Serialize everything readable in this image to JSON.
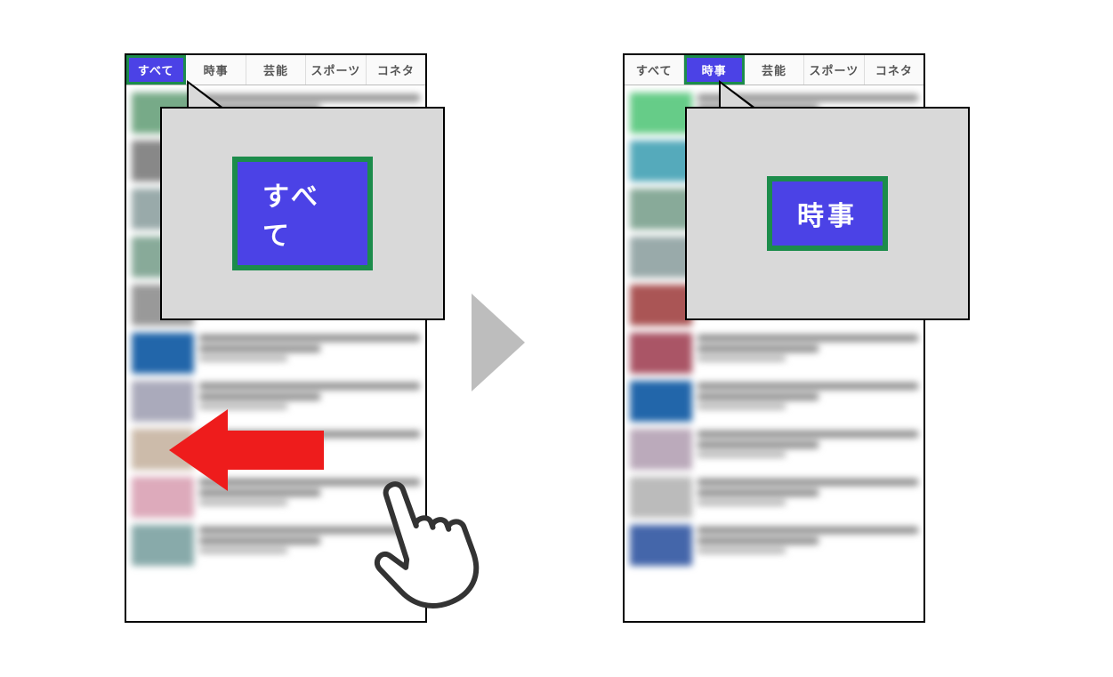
{
  "tabs": [
    {
      "label": "すべて"
    },
    {
      "label": "時事"
    },
    {
      "label": "芸能"
    },
    {
      "label": "スポーツ"
    },
    {
      "label": "コネタ"
    }
  ],
  "left": {
    "active_tab_index": 0,
    "callout_label": "すべて"
  },
  "right": {
    "active_tab_index": 1,
    "callout_label": "時事"
  },
  "colors": {
    "accent": "#4b42e6",
    "highlight_border": "#1c8c4b",
    "swipe_arrow": "#ee1c1c",
    "transition_chevron": "#bdbdbd",
    "callout_bg": "#d9d9d9"
  }
}
